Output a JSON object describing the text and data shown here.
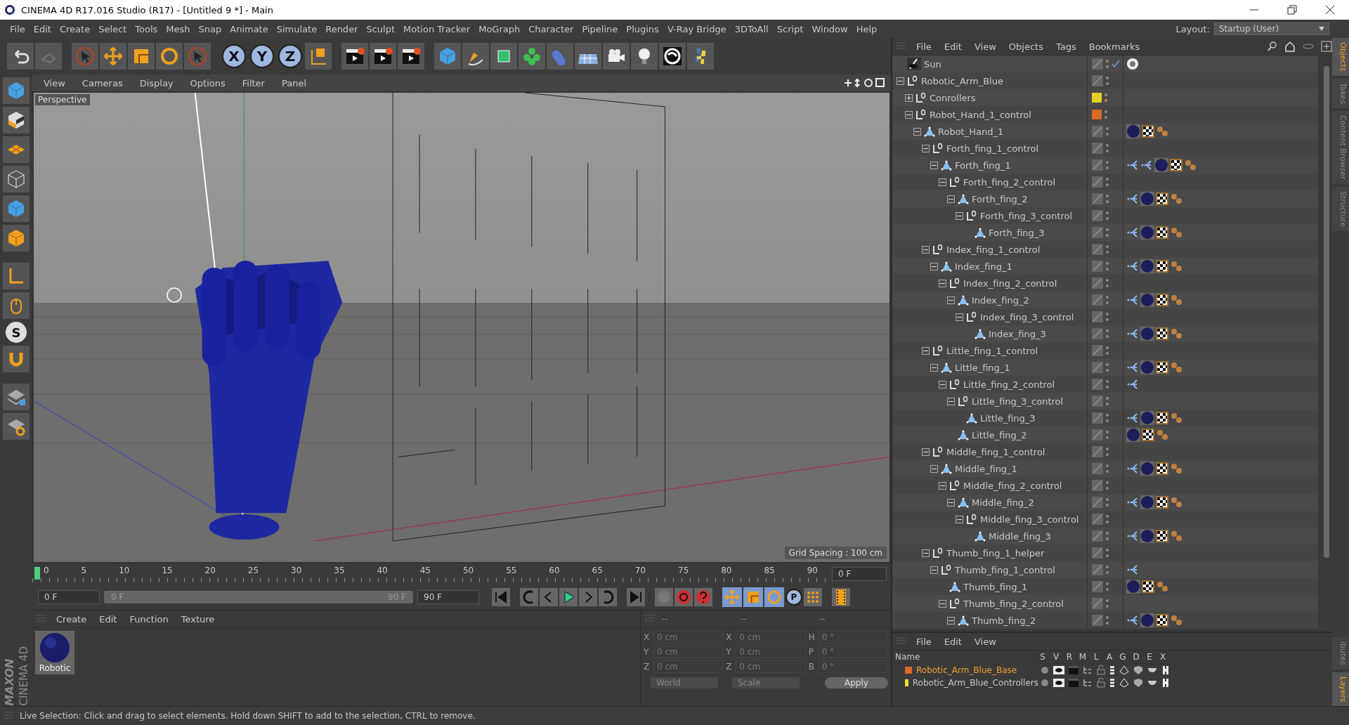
{
  "window": {
    "title": "CINEMA 4D R17.016 Studio (R17) - [Untitled 9 *] - Main"
  },
  "menu_bar": [
    "File",
    "Edit",
    "Create",
    "Select",
    "Tools",
    "Mesh",
    "Snap",
    "Animate",
    "Simulate",
    "Render",
    "Sculpt",
    "Motion Tracker",
    "MoGraph",
    "Character",
    "Pipeline",
    "Plugins",
    "V-Ray Bridge",
    "3DToAll",
    "Script",
    "Window",
    "Help"
  ],
  "layout": {
    "label": "Layout:",
    "value": "Startup (User)"
  },
  "axis_toggles": [
    "X",
    "Y",
    "Z"
  ],
  "left_toolbar": {
    "snap_letter": "S"
  },
  "viewport": {
    "menu": [
      "View",
      "Cameras",
      "Display",
      "Options",
      "Filter",
      "Panel"
    ],
    "camera": "Perspective",
    "grid_spacing": "Grid Spacing : 100 cm"
  },
  "timeline": {
    "ticks": [
      "0",
      "5",
      "10",
      "15",
      "20",
      "25",
      "30",
      "35",
      "40",
      "45",
      "50",
      "55",
      "60",
      "65",
      "70",
      "75",
      "80",
      "85",
      "90"
    ],
    "current_frame": "0 F"
  },
  "playback": {
    "start": "0 F",
    "range_start": "0 F",
    "range_end": "90 F",
    "end": "90 F",
    "key_letter": "P"
  },
  "material_manager": {
    "menu": [
      "Create",
      "Edit",
      "Function",
      "Texture"
    ],
    "materials": [
      {
        "name": "Robotic"
      }
    ]
  },
  "logo": {
    "brand": "MAXON",
    "product": "CINEMA 4D"
  },
  "coordinates": {
    "headers": [
      "--",
      "--",
      "--"
    ],
    "columns": [
      [
        {
          "label": "X",
          "value": "0 cm"
        },
        {
          "label": "Y",
          "value": "0 cm"
        },
        {
          "label": "Z",
          "value": "0 cm"
        }
      ],
      [
        {
          "label": "X",
          "value": "0 cm"
        },
        {
          "label": "Y",
          "value": "0 cm"
        },
        {
          "label": "Z",
          "value": "0 cm"
        }
      ],
      [
        {
          "label": "H",
          "value": "0 °"
        },
        {
          "label": "P",
          "value": "0 °"
        },
        {
          "label": "B",
          "value": "0 °"
        }
      ]
    ],
    "modes": [
      "World",
      "Scale"
    ],
    "apply": "Apply"
  },
  "status_bar": "Live Selection: Click and drag to select elements. Hold down SHIFT to add to the selection, CTRL to remove.",
  "object_manager": {
    "menu": [
      "File",
      "Edit",
      "View",
      "Objects",
      "Tags",
      "Bookmarks"
    ],
    "objects": [
      {
        "name": "Sun",
        "kind": "light",
        "enabled": true,
        "tags": [
          {
            "kind": "sun"
          }
        ]
      },
      {
        "name": "Robotic_Arm_Blue",
        "kind": "null",
        "expanded": true,
        "children": [
          {
            "name": "Conrollers",
            "kind": "null",
            "expanded": false,
            "color": "#e8d020"
          },
          {
            "name": "Robot_Hand_1_control",
            "kind": "null",
            "expanded": true,
            "color": "#d86a28",
            "children": [
              {
                "name": "Robot_Hand_1",
                "kind": "joint",
                "expanded": true,
                "tags": [
                  {
                    "kind": "material"
                  },
                  {
                    "kind": "texture"
                  },
                  {
                    "kind": "dots"
                  }
                ],
                "children": [
                  {
                    "name": "Forth_fing_1_control",
                    "kind": "null",
                    "expanded": true,
                    "children": [
                      {
                        "name": "Forth_fing_1",
                        "kind": "joint",
                        "expanded": true,
                        "tags": [
                          {
                            "kind": "ik"
                          },
                          {
                            "kind": "ik"
                          },
                          {
                            "kind": "material"
                          },
                          {
                            "kind": "texture"
                          },
                          {
                            "kind": "dots"
                          }
                        ],
                        "children": [
                          {
                            "name": "Forth_fing_2_control",
                            "kind": "null",
                            "expanded": true,
                            "children": [
                              {
                                "name": "Forth_fing_2",
                                "kind": "joint",
                                "expanded": true,
                                "tags": [
                                  {
                                    "kind": "ik"
                                  },
                                  {
                                    "kind": "material"
                                  },
                                  {
                                    "kind": "texture"
                                  },
                                  {
                                    "kind": "dots"
                                  }
                                ],
                                "children": [
                                  {
                                    "name": "Forth_fing_3_control",
                                    "kind": "null",
                                    "expanded": true,
                                    "children": [
                                      {
                                        "name": "Forth_fing_3",
                                        "kind": "joint",
                                        "tags": [
                                          {
                                            "kind": "ik"
                                          },
                                          {
                                            "kind": "material"
                                          },
                                          {
                                            "kind": "texture"
                                          },
                                          {
                                            "kind": "dots"
                                          }
                                        ]
                                      }
                                    ]
                                  }
                                ]
                              }
                            ]
                          }
                        ]
                      }
                    ]
                  },
                  {
                    "name": "Index_fing_1_control",
                    "kind": "null",
                    "expanded": true,
                    "children": [
                      {
                        "name": "Index_fing_1",
                        "kind": "joint",
                        "expanded": true,
                        "tags": [
                          {
                            "kind": "ik"
                          },
                          {
                            "kind": "material"
                          },
                          {
                            "kind": "texture"
                          },
                          {
                            "kind": "dots"
                          }
                        ],
                        "children": [
                          {
                            "name": "Index_fing_2_control",
                            "kind": "null",
                            "expanded": true,
                            "children": [
                              {
                                "name": "Index_fing_2",
                                "kind": "joint",
                                "expanded": true,
                                "tags": [
                                  {
                                    "kind": "ik"
                                  },
                                  {
                                    "kind": "material"
                                  },
                                  {
                                    "kind": "texture"
                                  },
                                  {
                                    "kind": "dots"
                                  }
                                ],
                                "children": [
                                  {
                                    "name": "Index_fing_3_control",
                                    "kind": "null",
                                    "expanded": true,
                                    "children": [
                                      {
                                        "name": "Index_fing_3",
                                        "kind": "joint",
                                        "tags": [
                                          {
                                            "kind": "ik"
                                          },
                                          {
                                            "kind": "material"
                                          },
                                          {
                                            "kind": "texture"
                                          },
                                          {
                                            "kind": "dots"
                                          }
                                        ]
                                      }
                                    ]
                                  }
                                ]
                              }
                            ]
                          }
                        ]
                      }
                    ]
                  },
                  {
                    "name": "Little_fing_1_control",
                    "kind": "null",
                    "expanded": true,
                    "children": [
                      {
                        "name": "Little_fing_1",
                        "kind": "joint",
                        "expanded": true,
                        "tags": [
                          {
                            "kind": "ik"
                          },
                          {
                            "kind": "material"
                          },
                          {
                            "kind": "texture"
                          },
                          {
                            "kind": "dots"
                          }
                        ],
                        "children": [
                          {
                            "name": "Little_fing_2_control",
                            "kind": "null",
                            "expanded": true,
                            "tags": [
                              {
                                "kind": "ik"
                              }
                            ],
                            "children": [
                              {
                                "name": "Little_fing_3_control",
                                "kind": "null",
                                "expanded": true,
                                "children": [
                                  {
                                    "name": "Little_fing_3",
                                    "kind": "joint",
                                    "tags": [
                                      {
                                        "kind": "ik"
                                      },
                                      {
                                        "kind": "material"
                                      },
                                      {
                                        "kind": "texture"
                                      },
                                      {
                                        "kind": "dots"
                                      }
                                    ]
                                  }
                                ]
                              },
                              {
                                "name": "Little_fing_2",
                                "kind": "joint",
                                "tags": [
                                  {
                                    "kind": "material"
                                  },
                                  {
                                    "kind": "texture"
                                  },
                                  {
                                    "kind": "dots"
                                  }
                                ]
                              }
                            ]
                          }
                        ]
                      }
                    ]
                  },
                  {
                    "name": "Middle_fing_1_control",
                    "kind": "null",
                    "expanded": true,
                    "children": [
                      {
                        "name": "Middle_fing_1",
                        "kind": "joint",
                        "expanded": true,
                        "tags": [
                          {
                            "kind": "ik"
                          },
                          {
                            "kind": "material"
                          },
                          {
                            "kind": "texture"
                          },
                          {
                            "kind": "dots"
                          }
                        ],
                        "children": [
                          {
                            "name": "Middle_fing_2_control",
                            "kind": "null",
                            "expanded": true,
                            "children": [
                              {
                                "name": "Middle_fing_2",
                                "kind": "joint",
                                "expanded": true,
                                "tags": [
                                  {
                                    "kind": "ik"
                                  },
                                  {
                                    "kind": "material"
                                  },
                                  {
                                    "kind": "texture"
                                  },
                                  {
                                    "kind": "dots"
                                  }
                                ],
                                "children": [
                                  {
                                    "name": "Middle_fing_3_control",
                                    "kind": "null",
                                    "expanded": true,
                                    "children": [
                                      {
                                        "name": "Middle_fing_3",
                                        "kind": "joint",
                                        "tags": [
                                          {
                                            "kind": "ik"
                                          },
                                          {
                                            "kind": "material"
                                          },
                                          {
                                            "kind": "texture"
                                          },
                                          {
                                            "kind": "dots"
                                          }
                                        ]
                                      }
                                    ]
                                  }
                                ]
                              }
                            ]
                          }
                        ]
                      }
                    ]
                  },
                  {
                    "name": "Thumb_fing_1_helper",
                    "kind": "null",
                    "expanded": true,
                    "children": [
                      {
                        "name": "Thumb_fing_1_control",
                        "kind": "null",
                        "expanded": true,
                        "tags": [
                          {
                            "kind": "ik"
                          }
                        ],
                        "children": [
                          {
                            "name": "Thumb_fing_1",
                            "kind": "joint",
                            "tags": [
                              {
                                "kind": "material"
                              },
                              {
                                "kind": "texture"
                              },
                              {
                                "kind": "dots"
                              }
                            ]
                          },
                          {
                            "name": "Thumb_fing_2_control",
                            "kind": "null",
                            "expanded": true,
                            "children": [
                              {
                                "name": "Thumb_fing_2",
                                "kind": "joint",
                                "expanded": true,
                                "tags": [
                                  {
                                    "kind": "ik"
                                  },
                                  {
                                    "kind": "material"
                                  },
                                  {
                                    "kind": "texture"
                                  },
                                  {
                                    "kind": "dots"
                                  }
                                ]
                              }
                            ]
                          }
                        ]
                      }
                    ]
                  }
                ]
              }
            ]
          }
        ]
      }
    ]
  },
  "side_tabs_top": [
    {
      "label": "Objects",
      "selected": true
    },
    {
      "label": "Takes",
      "selected": false
    },
    {
      "label": "Content Browser",
      "selected": false
    },
    {
      "label": "Structure",
      "selected": false
    }
  ],
  "layer_manager": {
    "menu": [
      "File",
      "Edit",
      "View"
    ],
    "columns": [
      "Name",
      "S",
      "V",
      "R",
      "M",
      "L",
      "A",
      "G",
      "D",
      "E",
      "X"
    ],
    "layers": [
      {
        "name": "Robotic_Arm_Blue_Base",
        "color": "#d86a28",
        "selected": true
      },
      {
        "name": "Robotic_Arm_Blue_Controllers",
        "color": "#e8e030",
        "selected": false
      }
    ]
  },
  "side_tabs_bottom": [
    {
      "label": "ibutes",
      "selected": false
    },
    {
      "label": "Layers",
      "selected": true
    }
  ]
}
